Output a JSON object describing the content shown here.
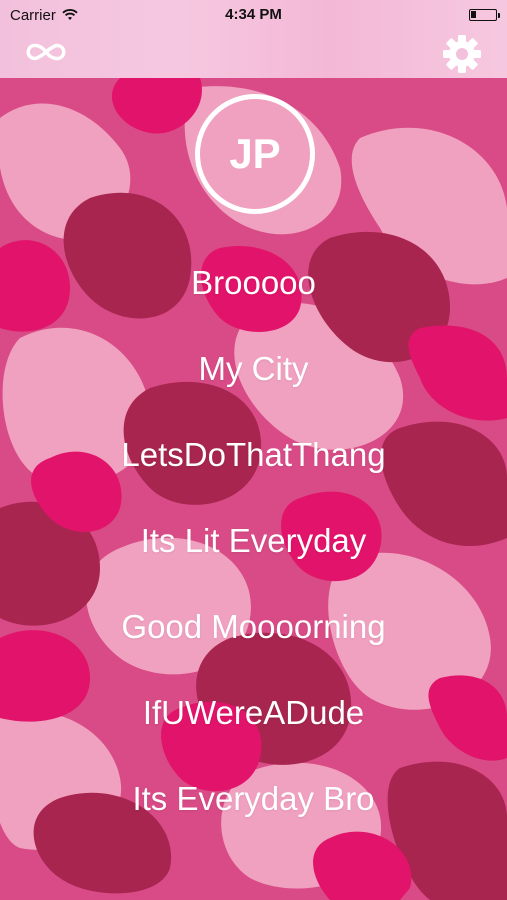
{
  "status_bar": {
    "carrier": "Carrier",
    "time": "4:34 PM",
    "battery_percent": 20
  },
  "nav": {
    "left_icon": "infinity-icon",
    "right_icon": "gear-icon"
  },
  "profile": {
    "initials": "JP"
  },
  "menu": {
    "items": [
      {
        "label": "Brooooo"
      },
      {
        "label": "My City"
      },
      {
        "label": "LetsDoThatThang"
      },
      {
        "label": "Its Lit Everyday"
      },
      {
        "label": "Good Moooorning"
      },
      {
        "label": "IfUWereADude"
      },
      {
        "label": "Its Everyday Bro"
      }
    ]
  },
  "colors": {
    "camo_base": "#d84b86",
    "camo_dark": "#a7254f",
    "camo_light": "#f0a1bf",
    "camo_hot": "#e2136a",
    "nav_bg": "#f3c1db",
    "text": "#ffffff"
  }
}
